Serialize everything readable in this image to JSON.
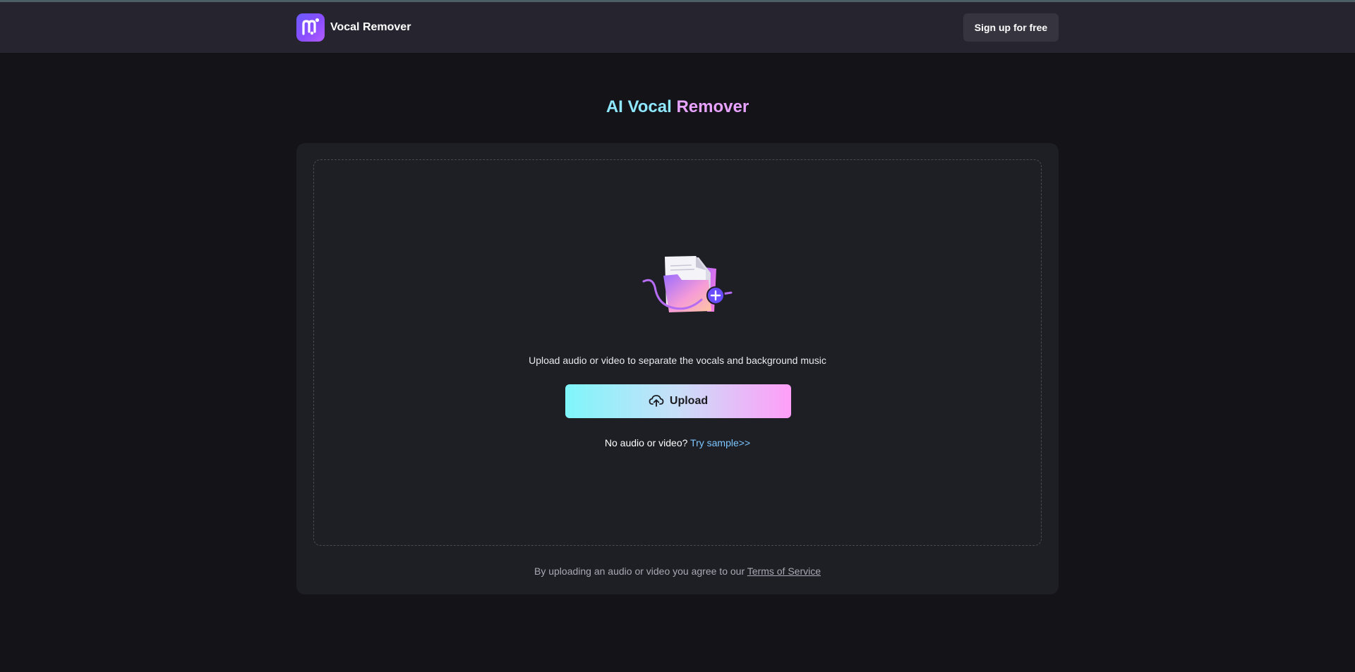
{
  "header": {
    "brand": "Vocal Remover",
    "signup_label": "Sign up for free"
  },
  "main": {
    "title_part1": "AI Vocal",
    "title_part2": "Remover",
    "description": "Upload audio or video to separate the vocals and background music",
    "upload_label": "Upload",
    "no_audio_text": "No audio or video?",
    "try_sample_label": "Try sample>>",
    "terms_prefix": "By uploading an audio or video you agree to our",
    "terms_link": "Terms of Service"
  },
  "colors": {
    "background": "#131318",
    "header": "#25242f",
    "card": "#1e1e25",
    "title_cyan": "#8fe8ff",
    "title_pink": "#e7a3ff",
    "link_blue": "#7cc6ff"
  },
  "icons": {
    "logo": "app-logo-icon",
    "upload": "cloud-upload-icon",
    "illustration": "folder-add-illustration"
  }
}
